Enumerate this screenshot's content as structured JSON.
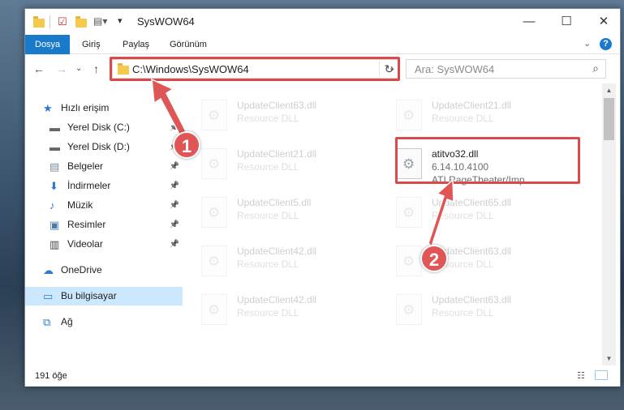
{
  "window": {
    "title": "SysWOW64"
  },
  "ribbon": {
    "tabs": [
      "Dosya",
      "Giriş",
      "Paylaş",
      "Görünüm"
    ],
    "active_tab": "Dosya"
  },
  "navbar": {
    "address": "C:\\Windows\\SysWOW64",
    "search_placeholder": "Ara: SysWOW64"
  },
  "sidebar": {
    "items": [
      {
        "label": "Hızlı erişim",
        "icon": "star-icon",
        "pinned": false
      },
      {
        "label": "Yerel Disk (C:)",
        "icon": "drive-icon",
        "pinned": true
      },
      {
        "label": "Yerel Disk (D:)",
        "icon": "drive-icon",
        "pinned": true
      },
      {
        "label": "Belgeler",
        "icon": "documents-icon",
        "pinned": true
      },
      {
        "label": "İndirmeler",
        "icon": "download-icon",
        "pinned": true
      },
      {
        "label": "Müzik",
        "icon": "music-icon",
        "pinned": true
      },
      {
        "label": "Resimler",
        "icon": "pictures-icon",
        "pinned": true
      },
      {
        "label": "Videolar",
        "icon": "videos-icon",
        "pinned": true
      },
      {
        "label": "OneDrive",
        "icon": "cloud-icon",
        "pinned": false
      },
      {
        "label": "Bu bilgisayar",
        "icon": "computer-icon",
        "pinned": false,
        "selected": true
      },
      {
        "label": "Ağ",
        "icon": "network-icon",
        "pinned": false
      }
    ]
  },
  "files": [
    {
      "name": "UpdateClient63.dll",
      "sub1": "Resource DLL",
      "sub2": ""
    },
    {
      "name": "UpdateClient21.dll",
      "sub1": "Resource DLL",
      "sub2": ""
    },
    {
      "name": "UpdateClient21.dll",
      "sub1": "Resource DLL",
      "sub2": ""
    },
    {
      "name": "atitvo32.dll",
      "sub1": "6.14.10.4100",
      "sub2": "ATI RageTheater/Imp...",
      "highlight": true
    },
    {
      "name": "UpdateClient5.dll",
      "sub1": "Resource DLL",
      "sub2": ""
    },
    {
      "name": "UpdateClient65.dll",
      "sub1": "Resource DLL",
      "sub2": ""
    },
    {
      "name": "UpdateClient42.dll",
      "sub1": "Resource DLL",
      "sub2": ""
    },
    {
      "name": "UpdateClient63.dll",
      "sub1": "Resource DLL",
      "sub2": ""
    },
    {
      "name": "UpdateClient42.dll",
      "sub1": "Resource DLL",
      "sub2": ""
    },
    {
      "name": "UpdateClient63.dll",
      "sub1": "Resource DLL",
      "sub2": ""
    }
  ],
  "status": {
    "item_count": "191 öğe"
  },
  "annotations": {
    "marker_1": "1",
    "marker_2": "2",
    "color": "#e05555"
  },
  "colors": {
    "accent": "#1979ca",
    "selection": "#cce8ff",
    "annotation_red": "#d94a4a"
  }
}
